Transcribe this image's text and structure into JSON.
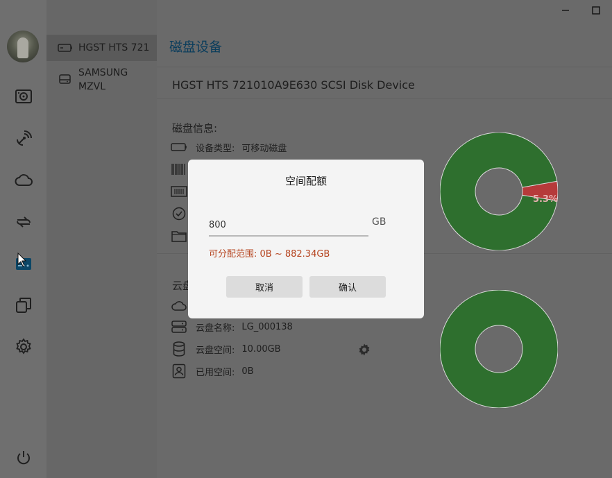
{
  "window": {
    "minimize_icon": "minimize-icon",
    "maximize_icon": "maximize-icon"
  },
  "sidebar": {
    "icons": [
      "disk-icon",
      "satellite-icon",
      "cloud-icon",
      "transfer-icon",
      "storage-active-icon",
      "copy-icon",
      "gear-icon",
      "power-icon"
    ]
  },
  "devices": [
    {
      "label": "HGST HTS 721",
      "icon": "disk-drive-icon",
      "active": true
    },
    {
      "label": "SAMSUNG MZVL",
      "icon": "ssd-icon",
      "active": false
    }
  ],
  "header": {
    "title": "磁盘设备"
  },
  "disk": {
    "full_name": "HGST HTS 721010A9E630 SCSI Disk Device",
    "info_title": "磁盘信息:",
    "rows": [
      {
        "label": "设备类型:",
        "value": "可移动磁盘"
      }
    ],
    "chart_percent_label": "5.3%"
  },
  "cloud": {
    "section_title": "云盘",
    "rows": [
      {
        "label": "云盘名称:",
        "value": "LG_000138"
      },
      {
        "label": "云盘空间:",
        "value": "10.00GB"
      },
      {
        "label": "已用空间:",
        "value": "0B"
      }
    ]
  },
  "dialog": {
    "title": "空间配额",
    "input_value": "800",
    "unit": "GB",
    "range_text": "可分配范围: 0B ~ 882.34GB",
    "cancel_label": "取消",
    "confirm_label": "确认"
  },
  "chart_data": [
    {
      "type": "pie",
      "categories": [
        "used",
        "free"
      ],
      "values": [
        5.3,
        94.7
      ],
      "data_labels": [
        "5.3%",
        ""
      ],
      "colors": [
        "#b63a3a",
        "#2e6f2e"
      ]
    },
    {
      "type": "pie",
      "categories": [
        "used",
        "free"
      ],
      "values": [
        0,
        100
      ],
      "colors": [
        "#b63a3a",
        "#2e6f2e"
      ]
    }
  ],
  "colors": {
    "accent": "#0b3d5c",
    "donut_green": "#2e6f2e",
    "donut_red": "#b63a3a",
    "range_text": "#b5431e"
  }
}
